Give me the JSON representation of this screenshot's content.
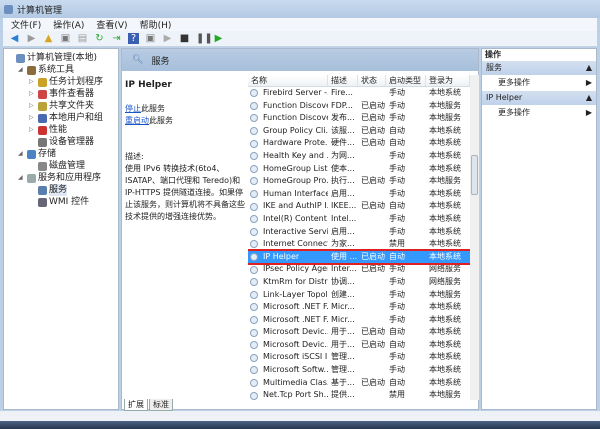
{
  "window": {
    "title": "计算机管理"
  },
  "menu": [
    "文件(F)",
    "操作(A)",
    "查看(V)",
    "帮助(H)"
  ],
  "tree": [
    {
      "label": "计算机管理(本地)",
      "level": 0
    },
    {
      "label": "系统工具",
      "level": 1
    },
    {
      "label": "任务计划程序",
      "level": 2
    },
    {
      "label": "事件查看器",
      "level": 2
    },
    {
      "label": "共享文件夹",
      "level": 2
    },
    {
      "label": "本地用户和组",
      "level": 2
    },
    {
      "label": "性能",
      "level": 2
    },
    {
      "label": "设备管理器",
      "level": 2
    },
    {
      "label": "存储",
      "level": 1
    },
    {
      "label": "磁盘管理",
      "level": 2
    },
    {
      "label": "服务和应用程序",
      "level": 1
    },
    {
      "label": "服务",
      "level": 2
    },
    {
      "label": "WMI 控件",
      "level": 2
    }
  ],
  "center": {
    "header": "服务",
    "service_name": "IP Helper",
    "stop_link": "停止",
    "stop_suffix": "此服务",
    "restart_link": "重启动",
    "restart_suffix": "此服务",
    "desc_label": "描述:",
    "description": "使用 IPv6 转换技术(6to4、ISATAP、端口代理和 Teredo)和 IP-HTTPS 提供隧道连接。如果停止该服务，则计算机将不具备这些技术提供的增强连接优势。"
  },
  "columns": [
    "名称",
    "描述",
    "状态",
    "启动类型",
    "登录为"
  ],
  "rows": [
    [
      "Firebird Server -...",
      "Fire...",
      "",
      "手动",
      "本地系统"
    ],
    [
      "Function Discove...",
      "FDP...",
      "已启动",
      "手动",
      "本地服务"
    ],
    [
      "Function Discove...",
      "发布...",
      "已启动",
      "手动",
      "本地服务"
    ],
    [
      "Group Policy Cli...",
      "该服...",
      "已启动",
      "自动",
      "本地系统"
    ],
    [
      "Hardware Prote...",
      "硬件...",
      "已启动",
      "自动",
      "本地系统"
    ],
    [
      "Health Key and ...",
      "为网...",
      "",
      "手动",
      "本地系统"
    ],
    [
      "HomeGroup List...",
      "使本...",
      "",
      "手动",
      "本地系统"
    ],
    [
      "HomeGroup Pro...",
      "执行...",
      "已启动",
      "手动",
      "本地服务"
    ],
    [
      "Human Interface...",
      "启用...",
      "",
      "手动",
      "本地系统"
    ],
    [
      "IKE and AuthIP I...",
      "IKEE...",
      "已启动",
      "自动",
      "本地系统"
    ],
    [
      "Intel(R) Content ...",
      "Intel...",
      "",
      "手动",
      "本地系统"
    ],
    [
      "Interactive Servi...",
      "启用...",
      "",
      "手动",
      "本地系统"
    ],
    [
      "Internet Connect...",
      "为家...",
      "",
      "禁用",
      "本地系统"
    ],
    [
      "IP Helper",
      "使用 ...",
      "已启动",
      "自动",
      "本地系统"
    ],
    [
      "IPsec Policy Agent",
      "Inter...",
      "已启动",
      "手动",
      "网络服务"
    ],
    [
      "KtmRm for Distri...",
      "协调...",
      "",
      "手动",
      "网络服务"
    ],
    [
      "Link-Layer Topol...",
      "创建...",
      "",
      "手动",
      "本地服务"
    ],
    [
      "Microsoft .NET F...",
      "Micr...",
      "",
      "手动",
      "本地系统"
    ],
    [
      "Microsoft .NET F...",
      "Micr...",
      "",
      "手动",
      "本地系统"
    ],
    [
      "Microsoft Devic...",
      "用于...",
      "已启动",
      "自动",
      "本地系统"
    ],
    [
      "Microsoft Devic...",
      "用于...",
      "已启动",
      "自动",
      "本地系统"
    ],
    [
      "Microsoft iSCSI I...",
      "管理...",
      "",
      "手动",
      "本地系统"
    ],
    [
      "Microsoft Softw...",
      "管理...",
      "",
      "手动",
      "本地系统"
    ],
    [
      "Multimedia Clas...",
      "基于...",
      "已启动",
      "自动",
      "本地系统"
    ],
    [
      "Net.Tcp Port Sh...",
      "提供...",
      "",
      "禁用",
      "本地服务"
    ]
  ],
  "selected_row": 13,
  "tabs": [
    "扩展",
    "标准"
  ],
  "actions": {
    "title": "操作",
    "sections": [
      {
        "name": "服务",
        "item": "更多操作"
      },
      {
        "name": "IP Helper",
        "item": "更多操作"
      }
    ]
  }
}
